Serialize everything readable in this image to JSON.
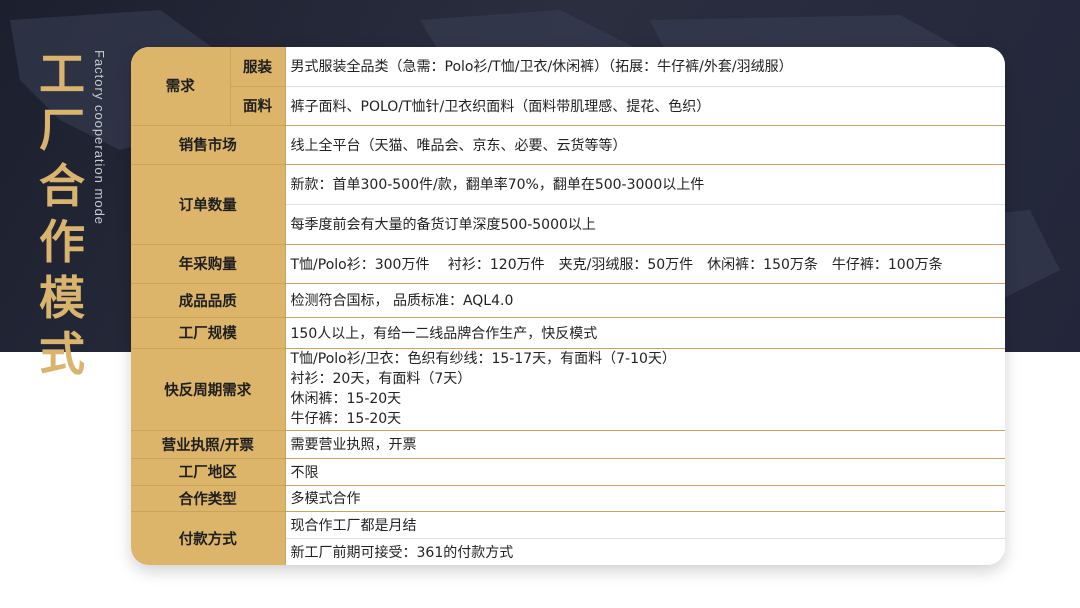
{
  "title": {
    "cn_chars": [
      "工",
      "厂",
      "合",
      "作",
      "模",
      "式"
    ],
    "en": "Factory cooperation mode"
  },
  "table": {
    "demand": {
      "label": "需求",
      "rows": [
        {
          "sub": "服装",
          "value": "男式服装全品类（急需：Polo衫/T恤/卫衣/休闲裤）（拓展：牛仔裤/外套/羽绒服）"
        },
        {
          "sub": "面料",
          "value": "裤子面料、POLO/T恤针/卫衣织面料（面料带肌理感、提花、色织）"
        }
      ]
    },
    "sales_market": {
      "label": "销售市场",
      "value": "线上全平台（天猫、唯品会、京东、必要、云货等等）"
    },
    "order_qty": {
      "label": "订单数量",
      "values": [
        "新款：首单300-500件/款，翻单率70%，翻单在500-3000以上件",
        "每季度前会有大量的备货订单深度500-5000以上"
      ]
    },
    "annual_purchase": {
      "label": "年采购量",
      "value": "T恤/Polo衫：300万件　 衬衫：120万件　夹克/羽绒服：50万件　休闲裤：150万条　牛仔裤：100万条"
    },
    "quality": {
      "label": "成品品质",
      "value": "检测符合国标， 品质标准：AQL4.0"
    },
    "factory_scale": {
      "label": "工厂规模",
      "value": "150人以上，有给一二线品牌合作生产，快反模式"
    },
    "quick_response": {
      "label": "快反周期需求",
      "lines": [
        "T恤/Polo衫/卫衣：色织有纱线：15-17天，有面料（7-10天）",
        "衬衫：20天，有面料（7天）",
        "休闲裤：15-20天",
        "牛仔裤：15-20天"
      ]
    },
    "license": {
      "label": "营业执照/开票",
      "value": "需要营业执照，开票"
    },
    "region": {
      "label": "工厂地区",
      "value": "不限"
    },
    "coop_type": {
      "label": "合作类型",
      "value": "多模式合作"
    },
    "payment": {
      "label": "付款方式",
      "values": [
        "现合作工厂都是月结",
        "新工厂前期可接受：361的付款方式"
      ]
    }
  },
  "colors": {
    "banner": "#23263a",
    "gold": "#ddb56a",
    "title_gold": "#d9b46e"
  }
}
